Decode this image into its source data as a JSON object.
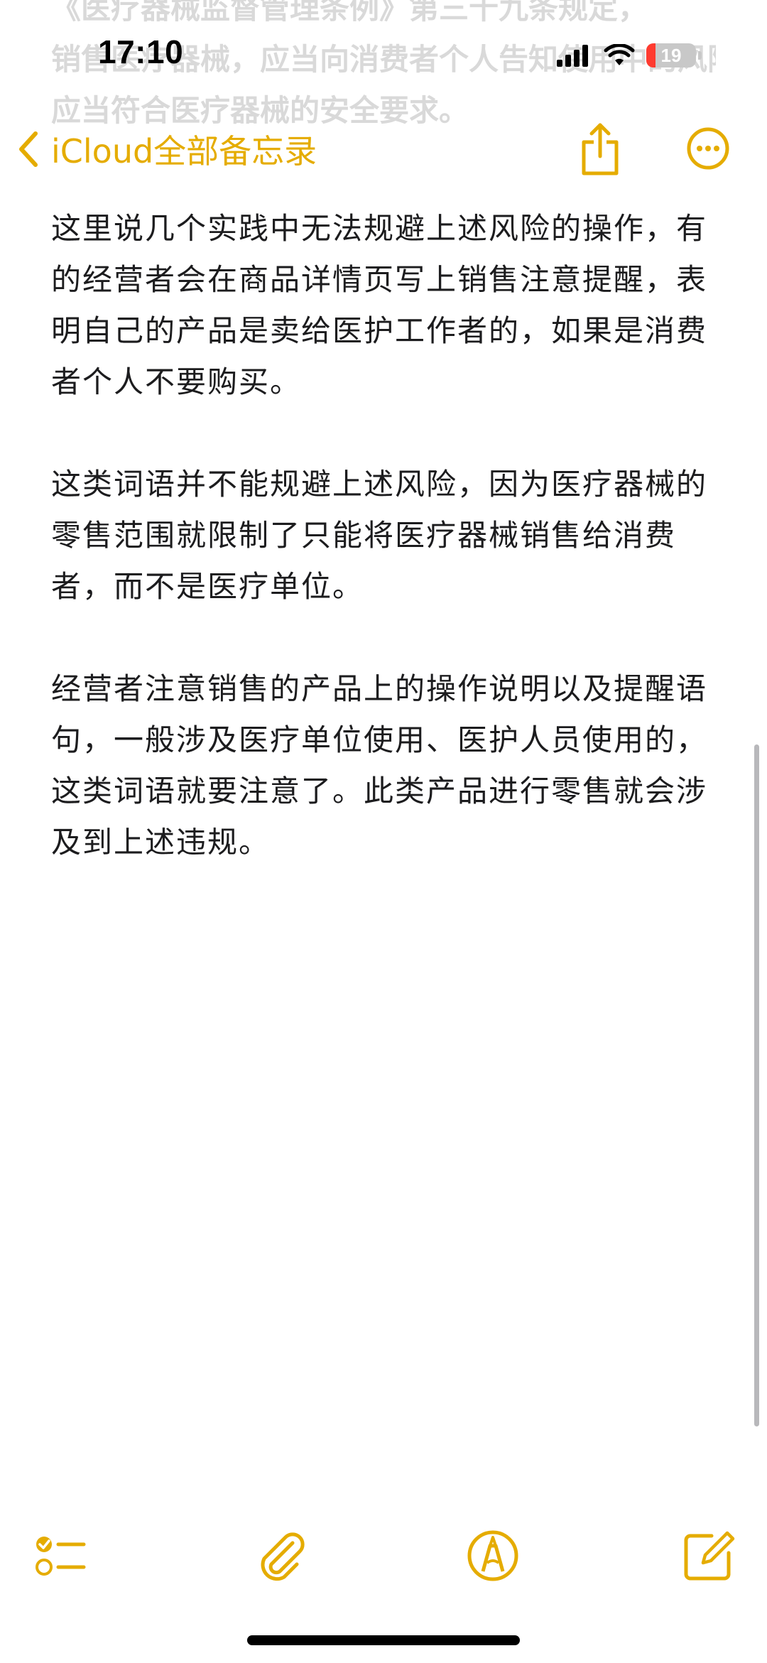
{
  "status_bar": {
    "time": "17:10",
    "battery_level": "19",
    "battery_fraction": 0.19,
    "signal_icon": "cellular-signal-icon",
    "wifi_icon": "wifi-icon",
    "battery_icon": "battery-icon"
  },
  "ghost_text": {
    "line1": "《医疗器械监督管理条例》第三十九条规定，",
    "line2": "销售医疗器械，应当向消费者个人告知使用中的风险",
    "line3": "应当符合医疗器械的安全要求。"
  },
  "nav": {
    "back_label": "iCloud全部备忘录",
    "back_icon": "chevron-left-icon",
    "share_icon": "share-icon",
    "more_icon": "ellipsis-circle-icon"
  },
  "note": {
    "paragraphs": [
      "这里说几个实践中无法规避上述风险的操作，有的经营者会在商品详情页写上销售注意提醒，表明自己的产品是卖给医护工作者的，如果是消费者个人不要购买。",
      "这类词语并不能规避上述风险，因为医疗器械的零售范围就限制了只能将医疗器械销售给消费者，而不是医疗单位。",
      "经营者注意销售的产品上的操作说明以及提醒语句，一般涉及医疗单位使用、医护人员使用的，这类词语就要注意了。此类产品进行零售就会涉及到上述违规。"
    ]
  },
  "toolbar": {
    "checklist_icon": "checklist-icon",
    "attach_icon": "paperclip-icon",
    "markup_icon": "pen-markup-icon",
    "compose_icon": "compose-icon"
  },
  "colors": {
    "accent": "#e5ac00",
    "text": "#1c1c1e",
    "battery_low": "#ff3b30"
  }
}
